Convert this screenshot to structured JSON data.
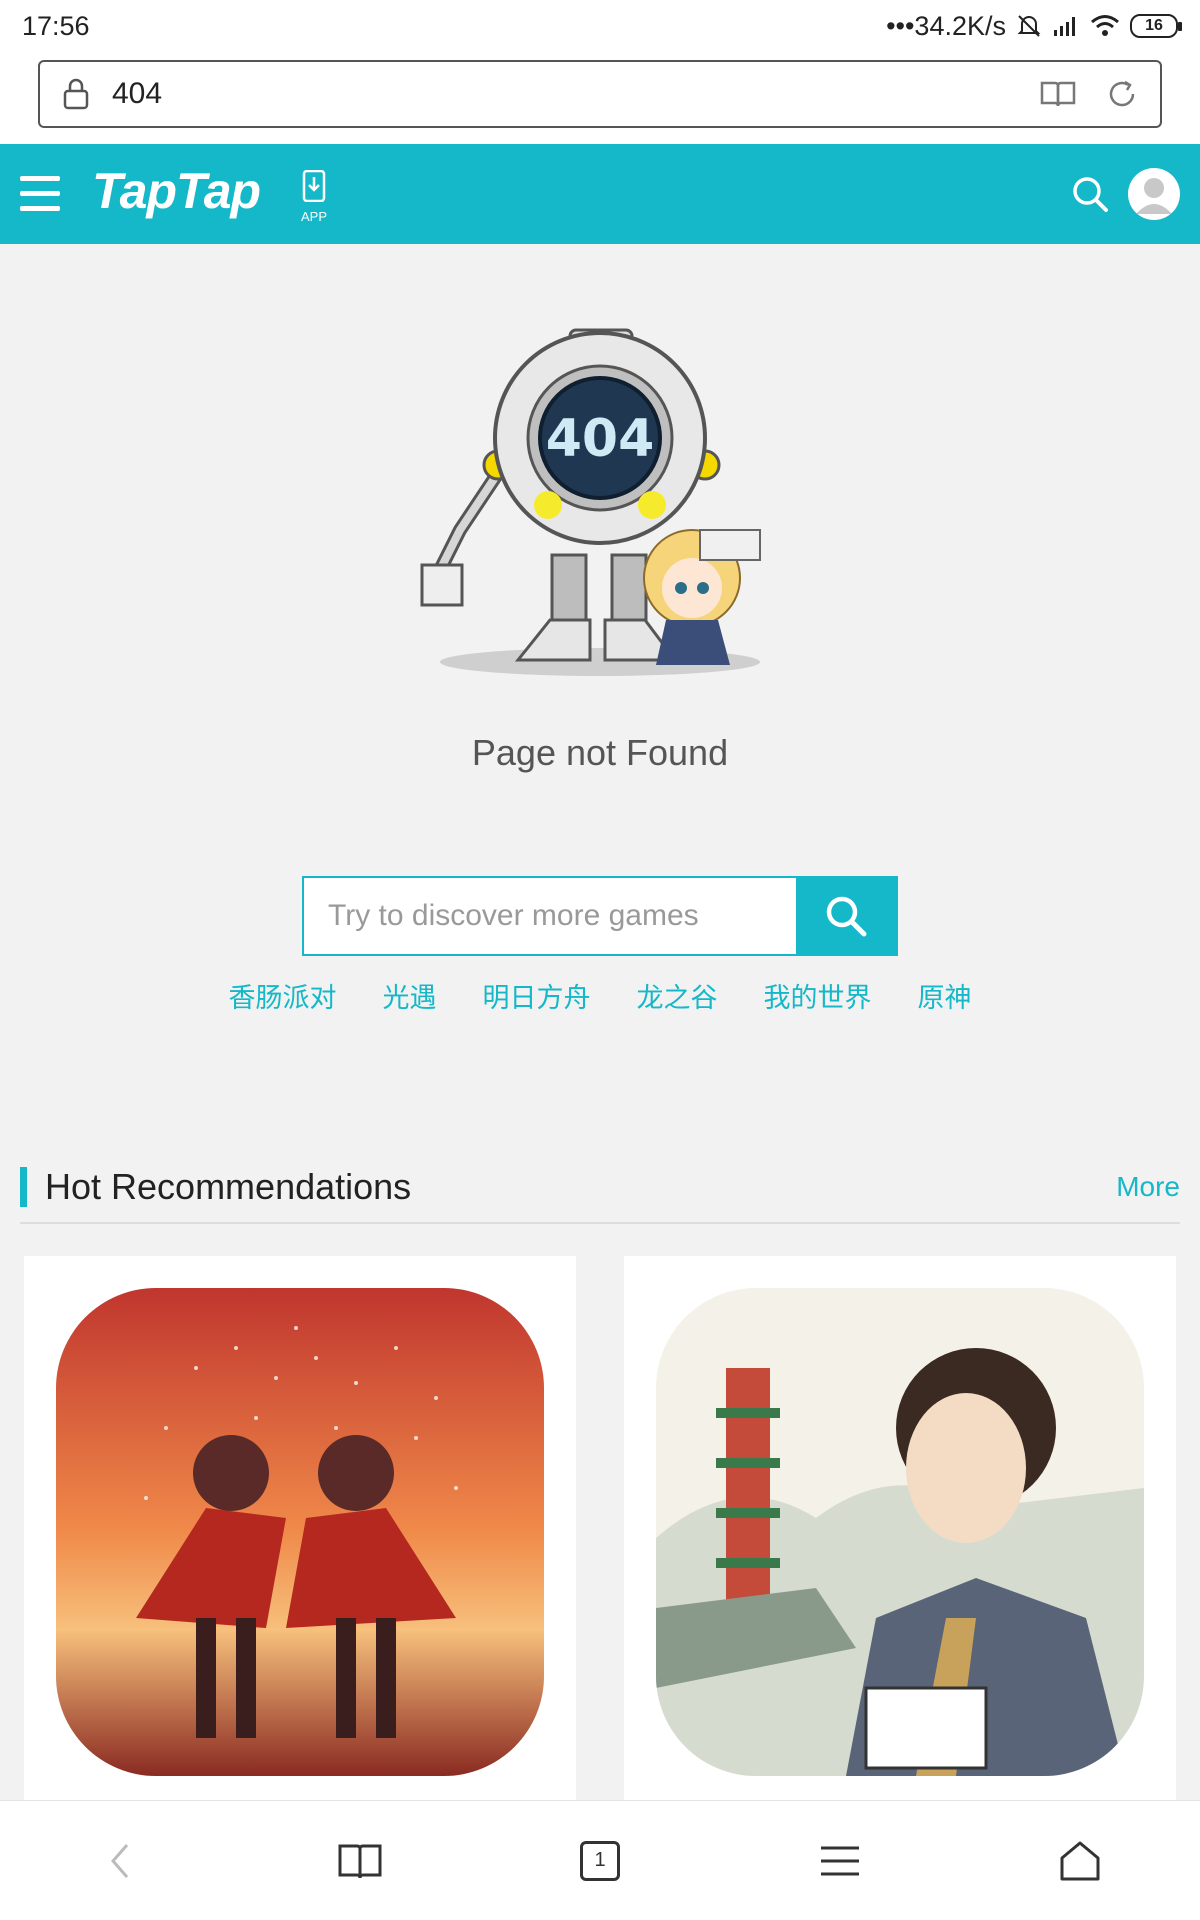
{
  "status": {
    "time": "17:56",
    "network_speed": "•••34.2K/s",
    "battery": "16"
  },
  "browser": {
    "url": "404",
    "tab_count": "1"
  },
  "header": {
    "logo": "TapTap",
    "app_label": "APP",
    "brand_color": "#15b8c8"
  },
  "error": {
    "code": "404",
    "message": "Page not Found"
  },
  "search": {
    "placeholder": "Try to discover more games",
    "keywords": [
      "香肠派对",
      "光遇",
      "明日方舟",
      "龙之谷",
      "我的世界",
      "原神"
    ]
  },
  "recommendations": {
    "title": "Hot Recommendations",
    "more_label": "More"
  }
}
